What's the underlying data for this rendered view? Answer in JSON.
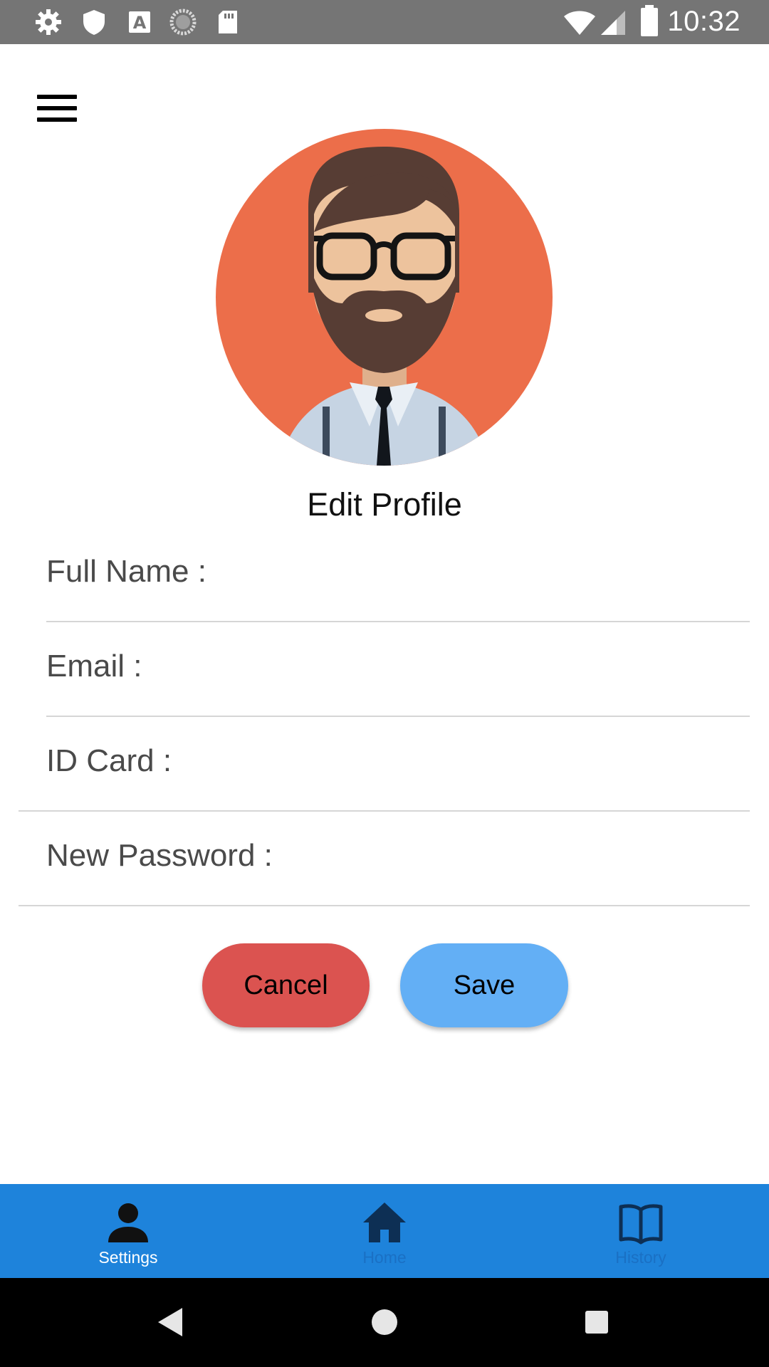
{
  "status_bar": {
    "time": "10:32",
    "left_icons": [
      "settings-icon",
      "shield-icon",
      "font-a-icon",
      "loading-circle-icon",
      "sd-card-icon"
    ],
    "right_icons": [
      "wifi-icon",
      "signal-icon",
      "battery-icon"
    ]
  },
  "header": {
    "menu_icon": "hamburger-menu-icon"
  },
  "profile": {
    "avatar_icon": "bearded-man-avatar",
    "title": "Edit Profile"
  },
  "form": {
    "full_name_label": "Full Name :",
    "email_label": "Email :",
    "id_card_label": "ID Card :",
    "new_password_label": "New Password :"
  },
  "buttons": {
    "cancel_label": "Cancel",
    "save_label": "Save"
  },
  "bottom_nav": {
    "items": [
      {
        "label": "Settings",
        "icon": "person-icon",
        "active": true
      },
      {
        "label": "Home",
        "icon": "home-icon",
        "active": false
      },
      {
        "label": "History",
        "icon": "book-icon",
        "active": false
      }
    ]
  },
  "system_nav": {
    "icons": [
      "back-icon",
      "home-circle-icon",
      "recents-square-icon"
    ]
  },
  "colors": {
    "status_bar": "#757575",
    "avatar_bg": "#ec6e4a",
    "cancel": "#db5350",
    "save": "#63aff5",
    "nav_bg": "#1e83db",
    "nav_active": "#ffffff",
    "nav_inactive": "#1a70c4"
  }
}
